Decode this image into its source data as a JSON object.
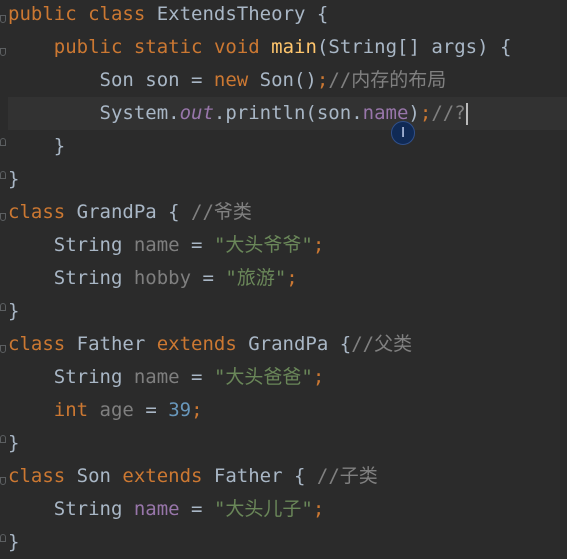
{
  "lines": [
    {
      "tokens": [
        {
          "t": "public",
          "c": "kw"
        },
        {
          "t": " "
        },
        {
          "t": "class",
          "c": "kw"
        },
        {
          "t": " ExtendsTheory {",
          "c": "ident"
        }
      ]
    },
    {
      "tokens": [
        {
          "t": "    "
        },
        {
          "t": "public",
          "c": "kw"
        },
        {
          "t": " "
        },
        {
          "t": "static",
          "c": "kw"
        },
        {
          "t": " "
        },
        {
          "t": "void",
          "c": "kw"
        },
        {
          "t": " "
        },
        {
          "t": "main",
          "c": "fn"
        },
        {
          "t": "(String[] args) {",
          "c": "ident"
        }
      ]
    },
    {
      "tokens": [
        {
          "t": "        Son son = ",
          "c": "ident"
        },
        {
          "t": "new",
          "c": "kw"
        },
        {
          "t": " Son()",
          "c": "ident"
        },
        {
          "t": ";",
          "c": "semi"
        },
        {
          "t": "//内存的布局",
          "c": "cmt"
        }
      ]
    },
    {
      "current": true,
      "caret": true,
      "tokens": [
        {
          "t": "        System.",
          "c": "ident"
        },
        {
          "t": "out",
          "c": "static-field"
        },
        {
          "t": ".println(son.",
          "c": "ident"
        },
        {
          "t": "name",
          "c": "field"
        },
        {
          "t": ")",
          "c": "ident"
        },
        {
          "t": ";",
          "c": "semi"
        },
        {
          "t": "//?",
          "c": "cmt"
        }
      ]
    },
    {
      "tokens": [
        {
          "t": "    }",
          "c": "ident"
        }
      ]
    },
    {
      "tokens": [
        {
          "t": "}",
          "c": "ident"
        }
      ]
    },
    {
      "tokens": [
        {
          "t": "class",
          "c": "kw"
        },
        {
          "t": " GrandPa { ",
          "c": "ident"
        },
        {
          "t": "//爷类",
          "c": "cmt"
        }
      ]
    },
    {
      "tokens": [
        {
          "t": "    String ",
          "c": "ident"
        },
        {
          "t": "name",
          "c": "field-unused"
        },
        {
          "t": " = ",
          "c": "ident"
        },
        {
          "t": "\"大头爷爷\"",
          "c": "str"
        },
        {
          "t": ";",
          "c": "semi"
        }
      ]
    },
    {
      "tokens": [
        {
          "t": "    String ",
          "c": "ident"
        },
        {
          "t": "hobby",
          "c": "field-unused"
        },
        {
          "t": " = ",
          "c": "ident"
        },
        {
          "t": "\"旅游\"",
          "c": "str"
        },
        {
          "t": ";",
          "c": "semi"
        }
      ]
    },
    {
      "tokens": [
        {
          "t": "}",
          "c": "ident"
        }
      ]
    },
    {
      "tokens": [
        {
          "t": "class",
          "c": "kw"
        },
        {
          "t": " Father ",
          "c": "ident"
        },
        {
          "t": "extends",
          "c": "kw"
        },
        {
          "t": " GrandPa {",
          "c": "ident"
        },
        {
          "t": "//父类",
          "c": "cmt"
        }
      ]
    },
    {
      "tokens": [
        {
          "t": "    String ",
          "c": "ident"
        },
        {
          "t": "name",
          "c": "field-unused"
        },
        {
          "t": " = ",
          "c": "ident"
        },
        {
          "t": "\"大头爸爸\"",
          "c": "str"
        },
        {
          "t": ";",
          "c": "semi"
        }
      ]
    },
    {
      "tokens": [
        {
          "t": "    "
        },
        {
          "t": "int",
          "c": "kw"
        },
        {
          "t": " "
        },
        {
          "t": "age",
          "c": "field-unused"
        },
        {
          "t": " = ",
          "c": "ident"
        },
        {
          "t": "39",
          "c": "num"
        },
        {
          "t": ";",
          "c": "semi"
        }
      ]
    },
    {
      "tokens": [
        {
          "t": "}",
          "c": "ident"
        }
      ]
    },
    {
      "tokens": [
        {
          "t": "class",
          "c": "kw"
        },
        {
          "t": " Son ",
          "c": "ident"
        },
        {
          "t": "extends",
          "c": "kw"
        },
        {
          "t": " Father { ",
          "c": "ident"
        },
        {
          "t": "//子类",
          "c": "cmt"
        }
      ]
    },
    {
      "tokens": [
        {
          "t": "    String ",
          "c": "ident"
        },
        {
          "t": "name",
          "c": "field"
        },
        {
          "t": " = ",
          "c": "ident"
        },
        {
          "t": "\"大头儿子\"",
          "c": "str"
        },
        {
          "t": ";",
          "c": "semi"
        }
      ]
    },
    {
      "tokens": [
        {
          "t": "}",
          "c": "ident"
        }
      ]
    }
  ],
  "cursor_glyph": "I"
}
